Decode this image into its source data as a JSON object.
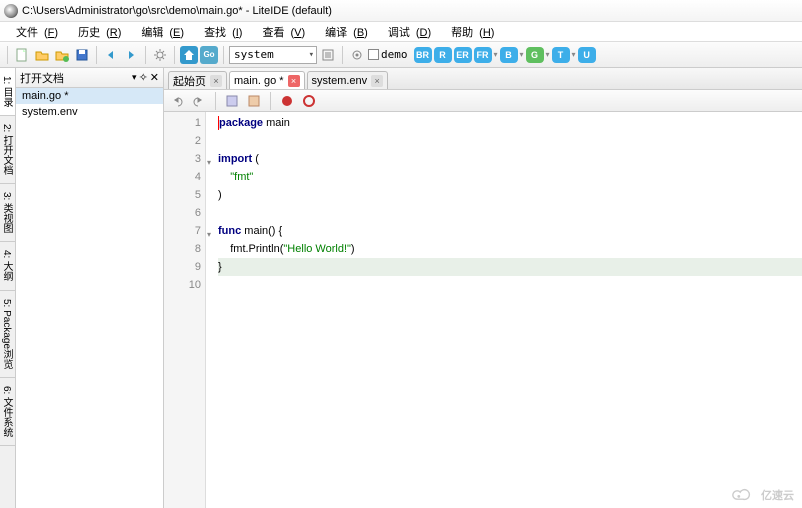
{
  "window": {
    "title": "C:\\Users\\Administrator\\go\\src\\demo\\main.go* - LiteIDE (default)"
  },
  "menu": {
    "file": "文件",
    "file_k": "F",
    "history": "历史",
    "history_k": "R",
    "edit": "编辑",
    "edit_k": "E",
    "find": "查找",
    "find_k": "I",
    "view": "查看",
    "view_k": "V",
    "build": "编译",
    "build_k": "B",
    "debug": "调试",
    "debug_k": "D",
    "help": "帮助",
    "help_k": "H"
  },
  "toolbar": {
    "env_selected": "system",
    "demo_label": "demo"
  },
  "pills": [
    "BR",
    "R",
    "ER",
    "FR",
    "B",
    "G",
    "T",
    "U"
  ],
  "pill_colors": [
    "#3daee9",
    "#3daee9",
    "#3daee9",
    "#3daee9",
    "#3daee9",
    "#5fbf5f",
    "#3daee9",
    "#3daee9"
  ],
  "sidebar": {
    "title": "打开文档",
    "items": [
      {
        "label": "main.go *",
        "active": true
      },
      {
        "label": "system.env",
        "active": false
      }
    ]
  },
  "leftrail": [
    "1: 目录",
    "2: 打开文档",
    "3: 类视图",
    "4: 大纲",
    "5: Package浏览",
    "6: 文件系统"
  ],
  "tabs": [
    {
      "label": "起始页",
      "close": "norm"
    },
    {
      "label": "main. go *",
      "close": "mod",
      "active": true
    },
    {
      "label": "system.env",
      "close": "norm"
    }
  ],
  "code": {
    "lines": [
      {
        "n": 1,
        "html": "<span class='kw'>package</span> main",
        "fold": false,
        "cursor": true
      },
      {
        "n": 2,
        "html": "",
        "fold": false
      },
      {
        "n": 3,
        "html": "<span class='kw'>import</span> (",
        "fold": true
      },
      {
        "n": 4,
        "html": "    <span class='str'>\"fmt\"</span>",
        "fold": false
      },
      {
        "n": 5,
        "html": ")",
        "fold": false
      },
      {
        "n": 6,
        "html": "",
        "fold": false
      },
      {
        "n": 7,
        "html": "<span class='kw'>func</span> main() {",
        "fold": true
      },
      {
        "n": 8,
        "html": "    fmt.Println(<span class='str'>\"Hello World!\"</span>)",
        "fold": false
      },
      {
        "n": 9,
        "html": "}",
        "fold": false,
        "hl": true
      },
      {
        "n": 10,
        "html": "",
        "fold": false
      }
    ]
  },
  "watermark": "亿速云"
}
